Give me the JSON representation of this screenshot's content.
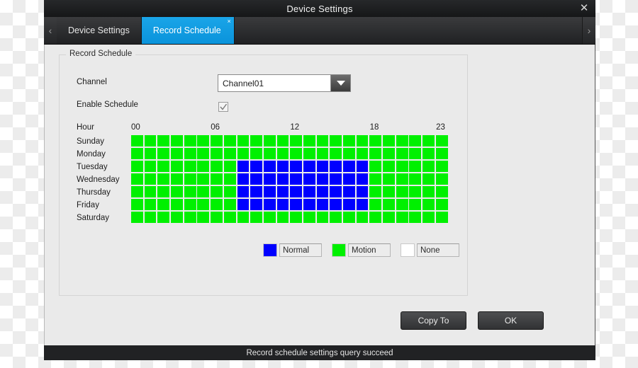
{
  "window": {
    "title": "Device Settings",
    "close_label": "✕"
  },
  "tabbar": {
    "prev_arrow": "‹",
    "next_arrow": "›",
    "tabs": [
      {
        "label": "Device Settings",
        "active": false
      },
      {
        "label": "Record Schedule",
        "active": true,
        "close_label": "×"
      }
    ]
  },
  "form": {
    "group_title": "Record Schedule",
    "channel_label": "Channel",
    "channel_value": "Channel01",
    "channel_options": [
      "Channel01"
    ],
    "enable_label": "Enable Schedule",
    "enable_checked": true,
    "hour_label": "Hour",
    "hour_ticks": [
      {
        "text": "00",
        "col": 0
      },
      {
        "text": "06",
        "col": 6
      },
      {
        "text": "12",
        "col": 12
      },
      {
        "text": "18",
        "col": 18
      },
      {
        "text": "23",
        "col": 23
      }
    ]
  },
  "schedule": {
    "days": [
      "Sunday",
      "Monday",
      "Tuesday",
      "Wednesday",
      "Thursday",
      "Friday",
      "Saturday"
    ],
    "hours": 24,
    "cells": [
      [
        "motion",
        "motion",
        "motion",
        "motion",
        "motion",
        "motion",
        "motion",
        "motion",
        "motion",
        "motion",
        "motion",
        "motion",
        "motion",
        "motion",
        "motion",
        "motion",
        "motion",
        "motion",
        "motion",
        "motion",
        "motion",
        "motion",
        "motion",
        "motion"
      ],
      [
        "motion",
        "motion",
        "motion",
        "motion",
        "motion",
        "motion",
        "motion",
        "motion",
        "motion",
        "motion",
        "motion",
        "motion",
        "motion",
        "motion",
        "motion",
        "motion",
        "motion",
        "motion",
        "motion",
        "motion",
        "motion",
        "motion",
        "motion",
        "motion"
      ],
      [
        "motion",
        "motion",
        "motion",
        "motion",
        "motion",
        "motion",
        "motion",
        "motion",
        "normal",
        "normal",
        "normal",
        "normal",
        "normal",
        "normal",
        "normal",
        "normal",
        "normal",
        "normal",
        "motion",
        "motion",
        "motion",
        "motion",
        "motion",
        "motion"
      ],
      [
        "motion",
        "motion",
        "motion",
        "motion",
        "motion",
        "motion",
        "motion",
        "motion",
        "normal",
        "normal",
        "normal",
        "normal",
        "normal",
        "normal",
        "normal",
        "normal",
        "normal",
        "normal",
        "motion",
        "motion",
        "motion",
        "motion",
        "motion",
        "motion"
      ],
      [
        "motion",
        "motion",
        "motion",
        "motion",
        "motion",
        "motion",
        "motion",
        "motion",
        "normal",
        "normal",
        "normal",
        "normal",
        "normal",
        "normal",
        "normal",
        "normal",
        "normal",
        "normal",
        "motion",
        "motion",
        "motion",
        "motion",
        "motion",
        "motion"
      ],
      [
        "motion",
        "motion",
        "motion",
        "motion",
        "motion",
        "motion",
        "motion",
        "motion",
        "normal",
        "normal",
        "normal",
        "normal",
        "normal",
        "normal",
        "normal",
        "normal",
        "normal",
        "normal",
        "motion",
        "motion",
        "motion",
        "motion",
        "motion",
        "motion"
      ],
      [
        "motion",
        "motion",
        "motion",
        "motion",
        "motion",
        "motion",
        "motion",
        "motion",
        "motion",
        "motion",
        "motion",
        "motion",
        "motion",
        "motion",
        "motion",
        "motion",
        "motion",
        "motion",
        "motion",
        "motion",
        "motion",
        "motion",
        "motion",
        "motion"
      ]
    ]
  },
  "legend": [
    {
      "label": "Normal",
      "color": "#0000FF",
      "key": "normal"
    },
    {
      "label": "Motion",
      "color": "#00F000",
      "key": "motion"
    },
    {
      "label": "None",
      "color": "#FFFFFF",
      "key": "none"
    }
  ],
  "actions": {
    "copy_to_label": "Copy To",
    "ok_label": "OK"
  },
  "statusbar": {
    "message": "Record schedule settings query succeed"
  }
}
